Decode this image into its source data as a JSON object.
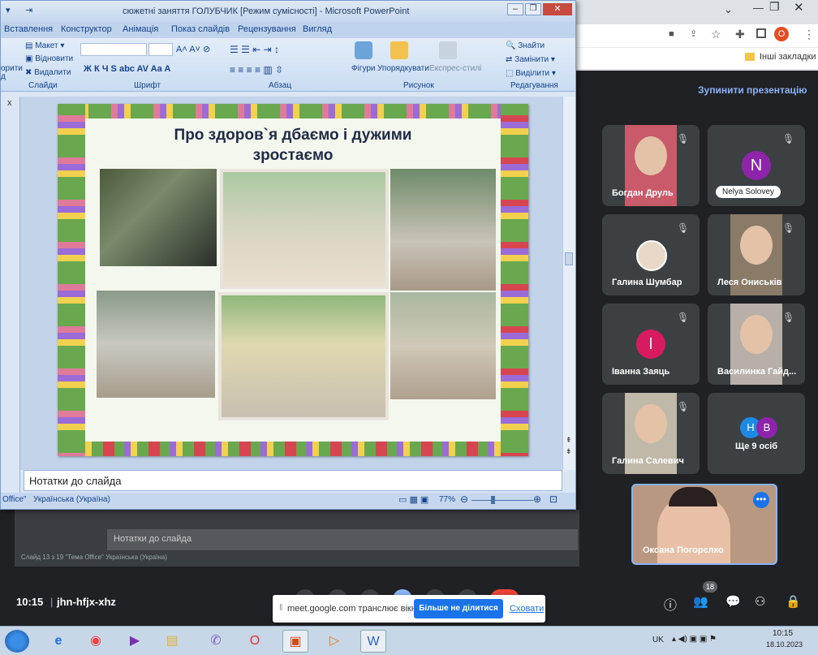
{
  "ppt": {
    "title": "сюжетні заняття ГОЛУБЧИК [Режим сумісності] - Microsoft PowerPoint",
    "tabs": [
      "Вставлення",
      "Конструктор",
      "Анімація",
      "Показ слайдів",
      "Рецензування",
      "Вигляд"
    ],
    "ribbon": {
      "maket": "Макет",
      "vidnovyty": "Відновити",
      "vydalyty": "Видалити",
      "slides_group": "Слайди",
      "font_group": "Шрифт",
      "para_group": "Абзац",
      "figures": "Фігури",
      "arrange": "Упорядкувати",
      "express": "Експрес-стилі",
      "drawing_group": "Рисунок",
      "find": "Знайти",
      "replace": "Замінити",
      "select": "Виділити",
      "edit_group": "Редагування",
      "left_cut": "орити",
      "left_cut2": "д"
    },
    "slide_title_line1": "Про здоров`я дбаємо і дужими",
    "slide_title_line2": "зростаємо",
    "notes": "Нотатки до слайда",
    "status_theme": "Office\"",
    "status_lang": "Українська (Україна)",
    "zoom": "77%",
    "bg_notes": "Нотатки до слайда",
    "bg_status": "Слайд 13 з 19    \"Тема Office\"    Українська (Україна)"
  },
  "chrome": {
    "bookmark": "Інші закладки",
    "avatar_letter": "О"
  },
  "meet": {
    "stop_btn": "Зупинити презентацію",
    "participants": [
      {
        "name": "Богдан Друль",
        "type": "video",
        "bg": "#c85a6a"
      },
      {
        "name": "Nelya Solovey",
        "type": "letter",
        "letter": "N",
        "color": "#8e24aa"
      },
      {
        "name": "Галина Шумбар",
        "type": "photo",
        "bg": "#e8d8c8"
      },
      {
        "name": "Леся Ониськів",
        "type": "video",
        "bg": "#8a7a68"
      },
      {
        "name": "Іванна Заяць",
        "type": "letter",
        "letter": "І",
        "color": "#d81b60"
      },
      {
        "name": "Василинка Гайд...",
        "type": "video",
        "bg": "#b8b0a8"
      },
      {
        "name": "Галина Салевич",
        "type": "video",
        "bg": "#c0b8a8"
      },
      {
        "name": "Ще 9 осіб",
        "type": "more",
        "letters": [
          "Н",
          "В"
        ]
      },
      {
        "name": "Оксана Погорєлко",
        "type": "self",
        "bg": "#b89880"
      }
    ],
    "time": "10:15",
    "code": "jhn-hfjx-xhz",
    "people_count": "18",
    "share_text": "meet.google.com транслює вікно.",
    "stop_share": "Більше не ділитися",
    "hide": "Сховати"
  },
  "taskbar": {
    "lang": "UK",
    "time": "10:15",
    "date": "18.10.2023"
  }
}
